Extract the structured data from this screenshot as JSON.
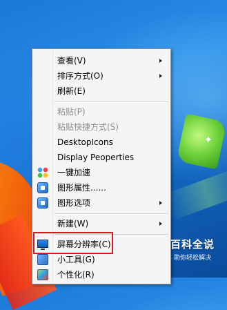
{
  "context_menu": {
    "items": [
      {
        "label": "查看(V)",
        "submenu": true,
        "disabled": false
      },
      {
        "label": "排序方式(O)",
        "submenu": true,
        "disabled": false
      },
      {
        "label": "刷新(E)",
        "submenu": false,
        "disabled": false
      },
      {
        "label": "粘贴(P)",
        "submenu": false,
        "disabled": true
      },
      {
        "label": "粘贴快捷方式(S)",
        "submenu": false,
        "disabled": true
      },
      {
        "label": "DesktopIcons",
        "submenu": false,
        "disabled": false
      },
      {
        "label": "Display Peoperties",
        "submenu": false,
        "disabled": false
      },
      {
        "label": "一键加速",
        "submenu": false,
        "disabled": false,
        "icon": "accelerate-icon"
      },
      {
        "label": "图形属性......",
        "submenu": false,
        "disabled": false,
        "icon": "graphics-properties-icon"
      },
      {
        "label": "图形选项",
        "submenu": true,
        "disabled": false,
        "icon": "graphics-options-icon"
      },
      {
        "label": "新建(W)",
        "submenu": true,
        "disabled": false
      },
      {
        "label": "屏幕分辨率(C)",
        "submenu": false,
        "disabled": false,
        "icon": "monitor-icon",
        "highlighted": true
      },
      {
        "label": "小工具(G)",
        "submenu": false,
        "disabled": false,
        "icon": "gadgets-icon"
      },
      {
        "label": "个性化(R)",
        "submenu": false,
        "disabled": false,
        "icon": "personalize-icon"
      }
    ]
  },
  "watermark": {
    "title": "百科全说",
    "subtitle": "助你轻松解决"
  },
  "colors": {
    "highlight_border": "#e0141e",
    "menu_background": "#f5f5f5",
    "disabled_text": "#8c8c8c"
  }
}
